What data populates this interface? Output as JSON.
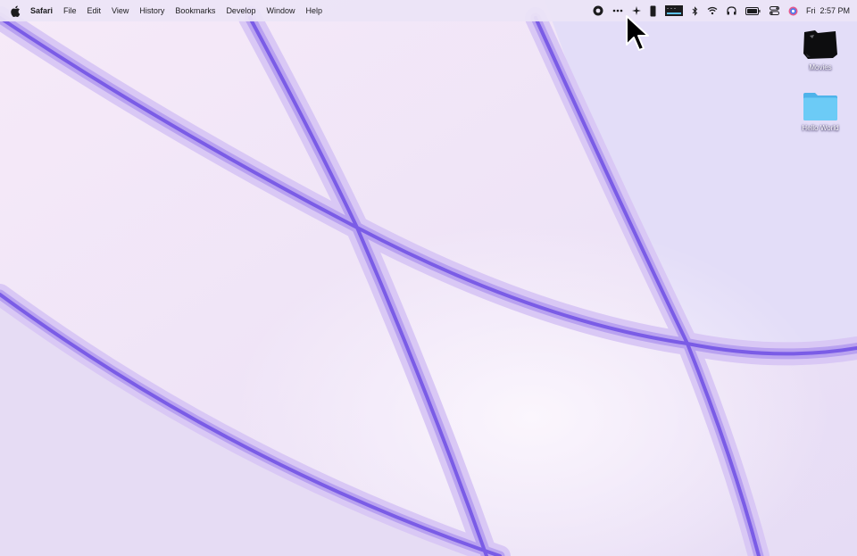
{
  "menubar": {
    "app_name": "Safari",
    "items": [
      {
        "label": "File"
      },
      {
        "label": "Edit"
      },
      {
        "label": "View"
      },
      {
        "label": "History"
      },
      {
        "label": "Bookmarks"
      },
      {
        "label": "Develop"
      },
      {
        "label": "Window"
      },
      {
        "label": "Help"
      }
    ],
    "status_icons": [
      "record-icon",
      "more-icon",
      "sparkle-icon",
      "phone-icon",
      "display-meter-icon",
      "bluetooth-icon",
      "wifi-icon",
      "headphones-icon",
      "battery-icon",
      "control-center-icon",
      "siri-icon"
    ],
    "clock": {
      "day": "Fri",
      "time": "2:57 PM"
    }
  },
  "desktop": {
    "icons": [
      {
        "label": "Movies",
        "icon": "movies-folder-icon"
      },
      {
        "label": "Hello World",
        "icon": "folder-icon"
      }
    ]
  },
  "colors": {
    "wallpaper_base": "#ece4f6",
    "wallpaper_accent": "#7a5ce6",
    "folder_blue": "#5ec2f2"
  }
}
